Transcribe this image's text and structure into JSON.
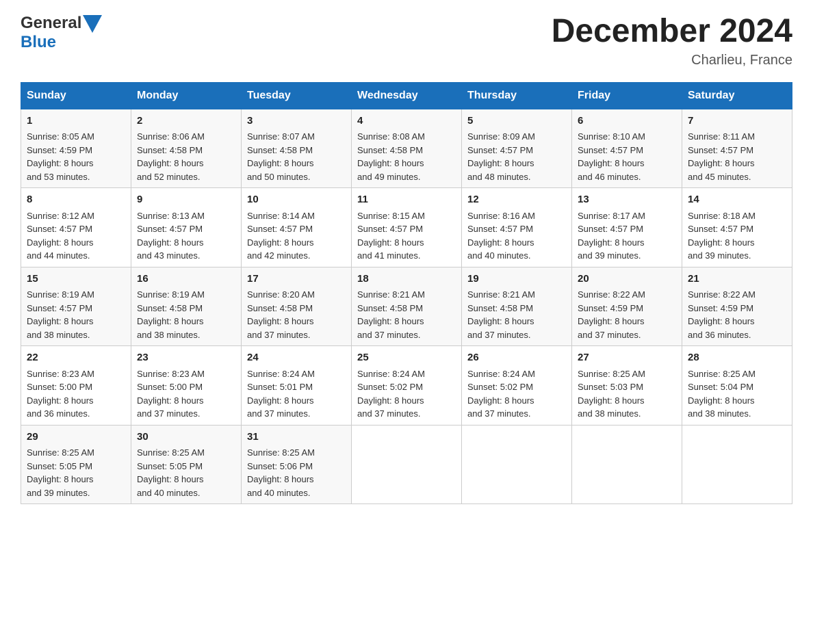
{
  "header": {
    "logo_general": "General",
    "logo_blue": "Blue",
    "month_title": "December 2024",
    "location": "Charlieu, France"
  },
  "calendar": {
    "days_of_week": [
      "Sunday",
      "Monday",
      "Tuesday",
      "Wednesday",
      "Thursday",
      "Friday",
      "Saturday"
    ],
    "weeks": [
      [
        {
          "day": "1",
          "sunrise": "Sunrise: 8:05 AM",
          "sunset": "Sunset: 4:59 PM",
          "daylight": "Daylight: 8 hours",
          "minutes": "and 53 minutes."
        },
        {
          "day": "2",
          "sunrise": "Sunrise: 8:06 AM",
          "sunset": "Sunset: 4:58 PM",
          "daylight": "Daylight: 8 hours",
          "minutes": "and 52 minutes."
        },
        {
          "day": "3",
          "sunrise": "Sunrise: 8:07 AM",
          "sunset": "Sunset: 4:58 PM",
          "daylight": "Daylight: 8 hours",
          "minutes": "and 50 minutes."
        },
        {
          "day": "4",
          "sunrise": "Sunrise: 8:08 AM",
          "sunset": "Sunset: 4:58 PM",
          "daylight": "Daylight: 8 hours",
          "minutes": "and 49 minutes."
        },
        {
          "day": "5",
          "sunrise": "Sunrise: 8:09 AM",
          "sunset": "Sunset: 4:57 PM",
          "daylight": "Daylight: 8 hours",
          "minutes": "and 48 minutes."
        },
        {
          "day": "6",
          "sunrise": "Sunrise: 8:10 AM",
          "sunset": "Sunset: 4:57 PM",
          "daylight": "Daylight: 8 hours",
          "minutes": "and 46 minutes."
        },
        {
          "day": "7",
          "sunrise": "Sunrise: 8:11 AM",
          "sunset": "Sunset: 4:57 PM",
          "daylight": "Daylight: 8 hours",
          "minutes": "and 45 minutes."
        }
      ],
      [
        {
          "day": "8",
          "sunrise": "Sunrise: 8:12 AM",
          "sunset": "Sunset: 4:57 PM",
          "daylight": "Daylight: 8 hours",
          "minutes": "and 44 minutes."
        },
        {
          "day": "9",
          "sunrise": "Sunrise: 8:13 AM",
          "sunset": "Sunset: 4:57 PM",
          "daylight": "Daylight: 8 hours",
          "minutes": "and 43 minutes."
        },
        {
          "day": "10",
          "sunrise": "Sunrise: 8:14 AM",
          "sunset": "Sunset: 4:57 PM",
          "daylight": "Daylight: 8 hours",
          "minutes": "and 42 minutes."
        },
        {
          "day": "11",
          "sunrise": "Sunrise: 8:15 AM",
          "sunset": "Sunset: 4:57 PM",
          "daylight": "Daylight: 8 hours",
          "minutes": "and 41 minutes."
        },
        {
          "day": "12",
          "sunrise": "Sunrise: 8:16 AM",
          "sunset": "Sunset: 4:57 PM",
          "daylight": "Daylight: 8 hours",
          "minutes": "and 40 minutes."
        },
        {
          "day": "13",
          "sunrise": "Sunrise: 8:17 AM",
          "sunset": "Sunset: 4:57 PM",
          "daylight": "Daylight: 8 hours",
          "minutes": "and 39 minutes."
        },
        {
          "day": "14",
          "sunrise": "Sunrise: 8:18 AM",
          "sunset": "Sunset: 4:57 PM",
          "daylight": "Daylight: 8 hours",
          "minutes": "and 39 minutes."
        }
      ],
      [
        {
          "day": "15",
          "sunrise": "Sunrise: 8:19 AM",
          "sunset": "Sunset: 4:57 PM",
          "daylight": "Daylight: 8 hours",
          "minutes": "and 38 minutes."
        },
        {
          "day": "16",
          "sunrise": "Sunrise: 8:19 AM",
          "sunset": "Sunset: 4:58 PM",
          "daylight": "Daylight: 8 hours",
          "minutes": "and 38 minutes."
        },
        {
          "day": "17",
          "sunrise": "Sunrise: 8:20 AM",
          "sunset": "Sunset: 4:58 PM",
          "daylight": "Daylight: 8 hours",
          "minutes": "and 37 minutes."
        },
        {
          "day": "18",
          "sunrise": "Sunrise: 8:21 AM",
          "sunset": "Sunset: 4:58 PM",
          "daylight": "Daylight: 8 hours",
          "minutes": "and 37 minutes."
        },
        {
          "day": "19",
          "sunrise": "Sunrise: 8:21 AM",
          "sunset": "Sunset: 4:58 PM",
          "daylight": "Daylight: 8 hours",
          "minutes": "and 37 minutes."
        },
        {
          "day": "20",
          "sunrise": "Sunrise: 8:22 AM",
          "sunset": "Sunset: 4:59 PM",
          "daylight": "Daylight: 8 hours",
          "minutes": "and 37 minutes."
        },
        {
          "day": "21",
          "sunrise": "Sunrise: 8:22 AM",
          "sunset": "Sunset: 4:59 PM",
          "daylight": "Daylight: 8 hours",
          "minutes": "and 36 minutes."
        }
      ],
      [
        {
          "day": "22",
          "sunrise": "Sunrise: 8:23 AM",
          "sunset": "Sunset: 5:00 PM",
          "daylight": "Daylight: 8 hours",
          "minutes": "and 36 minutes."
        },
        {
          "day": "23",
          "sunrise": "Sunrise: 8:23 AM",
          "sunset": "Sunset: 5:00 PM",
          "daylight": "Daylight: 8 hours",
          "minutes": "and 37 minutes."
        },
        {
          "day": "24",
          "sunrise": "Sunrise: 8:24 AM",
          "sunset": "Sunset: 5:01 PM",
          "daylight": "Daylight: 8 hours",
          "minutes": "and 37 minutes."
        },
        {
          "day": "25",
          "sunrise": "Sunrise: 8:24 AM",
          "sunset": "Sunset: 5:02 PM",
          "daylight": "Daylight: 8 hours",
          "minutes": "and 37 minutes."
        },
        {
          "day": "26",
          "sunrise": "Sunrise: 8:24 AM",
          "sunset": "Sunset: 5:02 PM",
          "daylight": "Daylight: 8 hours",
          "minutes": "and 37 minutes."
        },
        {
          "day": "27",
          "sunrise": "Sunrise: 8:25 AM",
          "sunset": "Sunset: 5:03 PM",
          "daylight": "Daylight: 8 hours",
          "minutes": "and 38 minutes."
        },
        {
          "day": "28",
          "sunrise": "Sunrise: 8:25 AM",
          "sunset": "Sunset: 5:04 PM",
          "daylight": "Daylight: 8 hours",
          "minutes": "and 38 minutes."
        }
      ],
      [
        {
          "day": "29",
          "sunrise": "Sunrise: 8:25 AM",
          "sunset": "Sunset: 5:05 PM",
          "daylight": "Daylight: 8 hours",
          "minutes": "and 39 minutes."
        },
        {
          "day": "30",
          "sunrise": "Sunrise: 8:25 AM",
          "sunset": "Sunset: 5:05 PM",
          "daylight": "Daylight: 8 hours",
          "minutes": "and 40 minutes."
        },
        {
          "day": "31",
          "sunrise": "Sunrise: 8:25 AM",
          "sunset": "Sunset: 5:06 PM",
          "daylight": "Daylight: 8 hours",
          "minutes": "and 40 minutes."
        },
        null,
        null,
        null,
        null
      ]
    ]
  }
}
